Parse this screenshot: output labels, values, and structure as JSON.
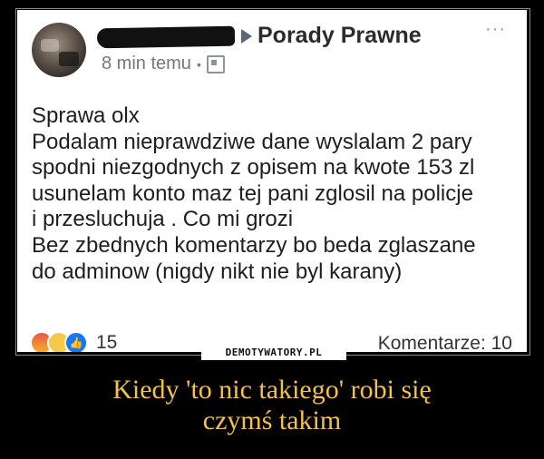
{
  "post": {
    "group_name": "Porady Prawne",
    "time": "8 min temu",
    "more_label": "···",
    "lines": [
      "Sprawa olx",
      "Podalam nieprawdziwe dane  wyslalam 2 pary",
      "spodni niezgodnych z opisem na kwote 153 zl",
      "usunelam konto  maz tej pani zglosil na policje",
      "i przesluchuja . Co mi grozi",
      "Bez zbednych komentarzy bo beda zglaszane",
      "do adminow  (nigdy nikt nie byl karany)"
    ],
    "reaction_count": "15",
    "comments": "Komentarze: 10"
  },
  "watermark": "DEMOTYWATORY.PL",
  "caption": {
    "line1": "Kiedy 'to nic takiego' robi się",
    "line2": "czymś takim"
  },
  "colors": {
    "caption": "#f2c24a",
    "background": "#000000",
    "like": "#1877f2"
  }
}
